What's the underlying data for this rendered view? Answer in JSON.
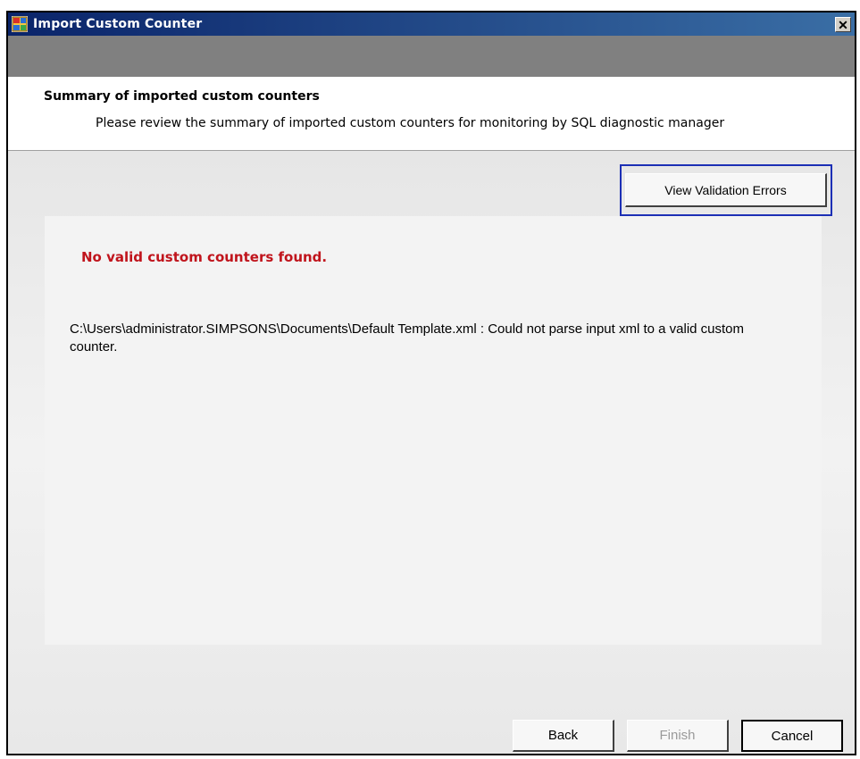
{
  "window": {
    "title": "Import Custom Counter",
    "close_symbol": "✕"
  },
  "header": {
    "title": "Summary of imported custom counters",
    "subtitle": "Please review the summary of imported custom counters for monitoring by SQL diagnostic manager"
  },
  "toolbar": {
    "view_errors_label": "View Validation Errors"
  },
  "content": {
    "error_heading": "No valid custom counters found.",
    "error_detail": "C:\\Users\\administrator.SIMPSONS\\Documents\\Default Template.xml : Could not parse input xml to a valid custom counter."
  },
  "footer": {
    "back_label": "Back",
    "finish_label": "Finish",
    "cancel_label": "Cancel"
  },
  "icons": {
    "app_icon": "app-window-icon",
    "close_icon": "close-icon"
  },
  "colors": {
    "titlebar_start": "#0a246a",
    "titlebar_end": "#3a6ea5",
    "error_text": "#c0141c",
    "focus_border": "#1c2fb5"
  }
}
